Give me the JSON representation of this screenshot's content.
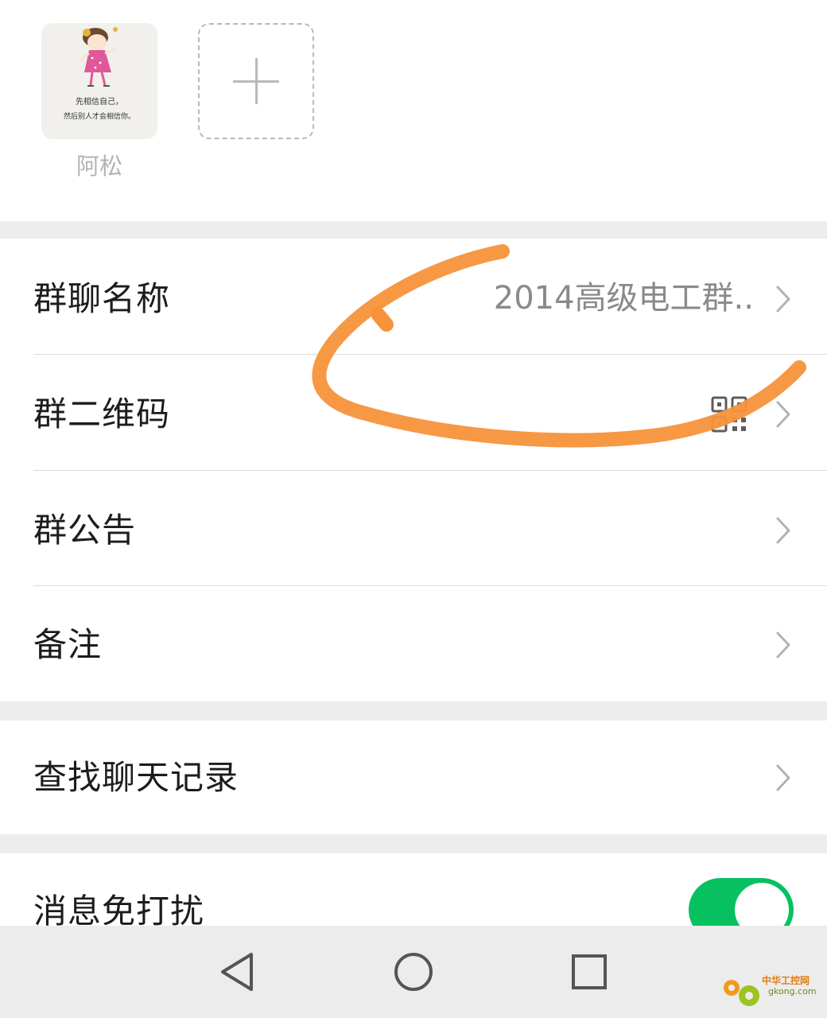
{
  "members": {
    "items": [
      {
        "name": "阿松",
        "avatar_caption_line1": "先相信自己，",
        "avatar_caption_line2": "然后别人才会相信你。"
      }
    ],
    "add_icon": "plus-icon"
  },
  "settings": {
    "group_name": {
      "label": "群聊名称",
      "value": "2014高级电工群.."
    },
    "qr_code": {
      "label": "群二维码",
      "icon": "qr-code-icon"
    },
    "announcement": {
      "label": "群公告"
    },
    "remark": {
      "label": "备注"
    },
    "search_history": {
      "label": "查找聊天记录"
    },
    "mute": {
      "label": "消息免打扰",
      "enabled": true
    }
  },
  "navbar": {
    "back_icon": "triangle-back-icon",
    "home_icon": "circle-home-icon",
    "recents_icon": "square-recents-icon"
  },
  "watermark": {
    "line1": "中华工控网",
    "line2": "gkong.com"
  },
  "colors": {
    "toggle_on": "#07c160",
    "annotation": "#f7923a",
    "background": "#ededed"
  }
}
